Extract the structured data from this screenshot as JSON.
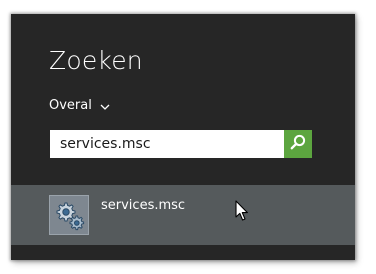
{
  "search_pane": {
    "title": "Zoeken",
    "scope": {
      "label": "Overal",
      "icon": "chevron-down-icon"
    },
    "search": {
      "value": "services.msc",
      "button_icon": "search-icon"
    },
    "results": [
      {
        "label": "services.msc",
        "icon": "services-gears-icon"
      }
    ]
  },
  "colors": {
    "pane_background": "#262626",
    "search_button": "#5ca53f",
    "selected_result": "#555a5c",
    "text": "#ffffff"
  }
}
